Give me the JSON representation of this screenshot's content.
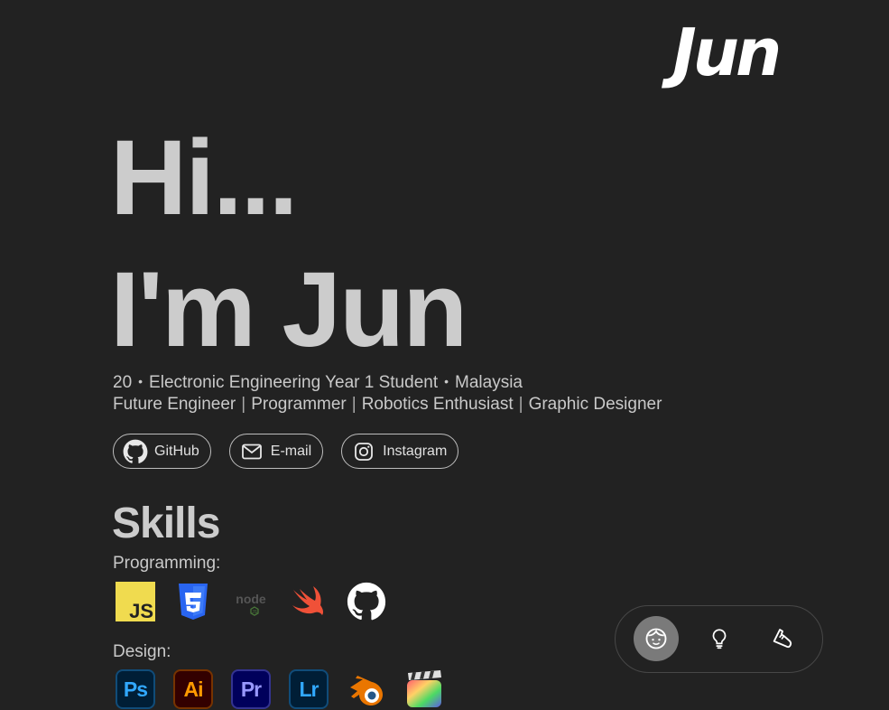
{
  "logo": {
    "text": "Jun"
  },
  "hero": {
    "line1": "Hi...",
    "line2": "I'm Jun"
  },
  "bio": {
    "line1": [
      "20",
      "Electronic Engineering Year 1 Student",
      "Malaysia"
    ],
    "line2": [
      "Future Engineer",
      "Programmer",
      "Robotics Enthusiast",
      "Graphic Designer"
    ]
  },
  "links": [
    {
      "label": "GitHub",
      "icon": "github-icon"
    },
    {
      "label": "E-mail",
      "icon": "mail-icon"
    },
    {
      "label": "Instagram",
      "icon": "instagram-icon"
    }
  ],
  "skills": {
    "title": "Skills",
    "programming_label": "Programming:",
    "programming": [
      {
        "name": "javascript-icon",
        "text": "JS",
        "color": "#f0db4f"
      },
      {
        "name": "css3-icon",
        "text": "3",
        "color": "#2965f1"
      },
      {
        "name": "nodejs-icon",
        "text": "node",
        "color": "#5a5a5a"
      },
      {
        "name": "swift-icon",
        "color": "#f05138"
      },
      {
        "name": "github-icon",
        "color": "#ffffff"
      }
    ],
    "design_label": "Design:",
    "design": [
      {
        "name": "photoshop-icon",
        "text": "Ps",
        "bg": "#001e36",
        "fg": "#31a8ff"
      },
      {
        "name": "illustrator-icon",
        "text": "Ai",
        "bg": "#330000",
        "fg": "#ff9a00"
      },
      {
        "name": "premiere-icon",
        "text": "Pr",
        "bg": "#00005b",
        "fg": "#9999ff"
      },
      {
        "name": "lightroom-icon",
        "text": "Lr",
        "bg": "#001e36",
        "fg": "#31a8ff"
      },
      {
        "name": "blender-icon",
        "color": "#ea7600"
      },
      {
        "name": "final-cut-pro-icon"
      }
    ]
  },
  "dock": [
    {
      "icon": "face-icon",
      "active": true
    },
    {
      "icon": "lightbulb-icon",
      "active": false
    },
    {
      "icon": "shoe-icon",
      "active": false
    }
  ]
}
